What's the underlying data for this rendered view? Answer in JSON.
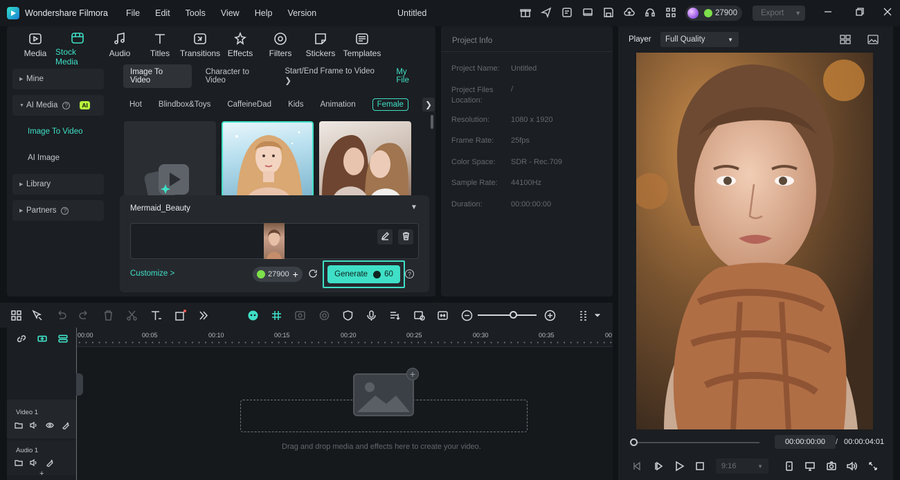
{
  "app": {
    "name": "Wondershare Filmora",
    "menu": [
      "File",
      "Edit",
      "Tools",
      "View",
      "Help",
      "Version"
    ],
    "document_title": "Untitled",
    "credits": "27900",
    "export_label": "Export"
  },
  "media_tabs": [
    {
      "label": "Media",
      "icon": "media-icon"
    },
    {
      "label": "Stock Media",
      "icon": "stock-media-icon",
      "active": true
    },
    {
      "label": "Audio",
      "icon": "audio-icon"
    },
    {
      "label": "Titles",
      "icon": "titles-icon"
    },
    {
      "label": "Transitions",
      "icon": "transitions-icon"
    },
    {
      "label": "Effects",
      "icon": "effects-icon"
    },
    {
      "label": "Filters",
      "icon": "filters-icon"
    },
    {
      "label": "Stickers",
      "icon": "stickers-icon"
    },
    {
      "label": "Templates",
      "icon": "templates-icon"
    }
  ],
  "sidebar": {
    "mine": "Mine",
    "ai_media": "AI Media",
    "ai_badge": "AI",
    "image_to_video": "Image To Video",
    "ai_image": "AI Image",
    "library": "Library",
    "partners": "Partners",
    "help_glyph": "?"
  },
  "subtabs": {
    "image_to_video": "Image To Video",
    "character_to_video": "Character to Video",
    "start_end_frame": "Start/End Frame to Video",
    "my_file": "My File"
  },
  "categories": [
    "Hot",
    "Blindbox&Toys",
    "CaffeineDad",
    "Kids",
    "Animation",
    "Female"
  ],
  "generate_panel": {
    "template_name": "Mermaid_Beauty",
    "customize_label": "Customize >",
    "credits": "27900",
    "generate_label": "Generate",
    "generate_cost": "60",
    "help_glyph": "?"
  },
  "project_info": {
    "title": "Project Info",
    "rows": [
      {
        "label": "Project Name:",
        "value": "Untitled"
      },
      {
        "label": "Project Files Location:",
        "value": "/"
      },
      {
        "label": "Resolution:",
        "value": "1080 x 1920"
      },
      {
        "label": "Frame Rate:",
        "value": "25fps"
      },
      {
        "label": "Color Space:",
        "value": "SDR - Rec.709"
      },
      {
        "label": "Sample Rate:",
        "value": "44100Hz"
      },
      {
        "label": "Duration:",
        "value": "00:00:00:00"
      }
    ]
  },
  "player": {
    "label": "Player",
    "quality": "Full Quality",
    "current_time": "00:00:00:00",
    "separator": "/",
    "total_time": "00:00:04:01",
    "aspect_ratio": "9:16"
  },
  "timeline": {
    "ruler_labels": [
      "00:00",
      "00:05",
      "00:10",
      "00:15",
      "00:20",
      "00:25",
      "00:30",
      "00:35",
      "00"
    ],
    "drop_hint": "Drag and drop media and effects here to create your video.",
    "video_track": "Video 1",
    "audio_track": "Audio 1",
    "add_track_glyph": "+"
  },
  "colors": {
    "accent": "#3fe0c7",
    "ai_badge": "#b6f23b",
    "coin": "#7ee04a"
  }
}
